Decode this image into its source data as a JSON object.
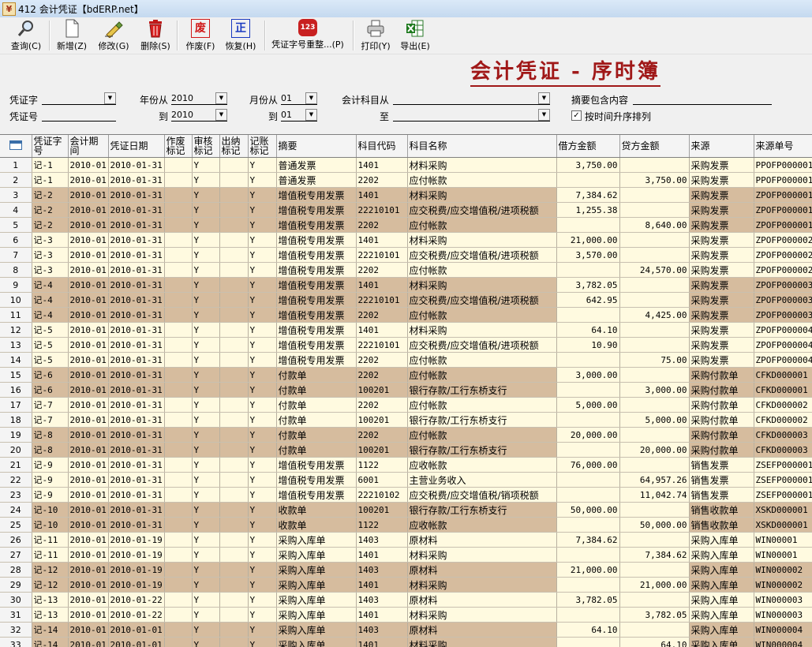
{
  "window": {
    "title": "412 会计凭证【bdERP.net】",
    "icon": "rmb-icon"
  },
  "toolbar": [
    {
      "name": "query-button",
      "icon": "magnifier-icon",
      "label": "查询(C)"
    },
    {
      "name": "new-button",
      "icon": "new-document-icon",
      "label": "新增(Z)"
    },
    {
      "name": "edit-button",
      "icon": "edit-pen-icon",
      "label": "修改(G)"
    },
    {
      "name": "delete-button",
      "icon": "trash-icon",
      "label": "删除(S)"
    },
    {
      "name": "void-button",
      "icon": "void-stamp-icon",
      "glyph": "废",
      "label": "作废(F)"
    },
    {
      "name": "restore-button",
      "icon": "restore-stamp-icon",
      "glyph": "正",
      "label": "恢复(H)"
    },
    {
      "name": "renumber-button",
      "icon": "renumber-icon",
      "glyph": "123",
      "label": "凭证字号重整...(P)"
    },
    {
      "name": "print-button",
      "icon": "printer-icon",
      "label": "打印(Y)"
    },
    {
      "name": "export-button",
      "icon": "excel-icon",
      "label": "导出(E)"
    }
  ],
  "page_title": "会计凭证 - 序时簿",
  "filters": {
    "voucher_word_label": "凭证字",
    "voucher_no_label": "凭证号",
    "year_from_label": "年份从",
    "year_from": "2010",
    "year_to_label": "到",
    "year_to": "2010",
    "month_from_label": "月份从",
    "month_from": "01",
    "month_to_label": "到",
    "month_to": "01",
    "account_from_label": "会计科目从",
    "account_to_label": "至",
    "summary_contains_label": "摘要包含内容",
    "sort_checkbox_label": "按时间升序排列",
    "sort_checked": true
  },
  "columns": [
    "凭证字号",
    "会计期间",
    "凭证日期",
    "作废标记",
    "审核标记",
    "出纳标记",
    "记账标记",
    "摘要",
    "科目代码",
    "科目名称",
    "借方金额",
    "贷方金额",
    "来源",
    "来源单号"
  ],
  "rows": [
    [
      "1",
      "记-1",
      "2010-01",
      "2010-01-31",
      "",
      "Y",
      "",
      "Y",
      "普通发票",
      "1401",
      "材料采购",
      "3,750.00",
      "",
      "采购发票",
      "PPOFP000001"
    ],
    [
      "2",
      "记-1",
      "2010-01",
      "2010-01-31",
      "",
      "Y",
      "",
      "Y",
      "普通发票",
      "2202",
      "应付帐款",
      "",
      "3,750.00",
      "采购发票",
      "PPOFP000001"
    ],
    [
      "3",
      "记-2",
      "2010-01",
      "2010-01-31",
      "",
      "Y",
      "",
      "Y",
      "增值税专用发票",
      "1401",
      "材料采购",
      "7,384.62",
      "",
      "采购发票",
      "ZPOFP000001"
    ],
    [
      "4",
      "记-2",
      "2010-01",
      "2010-01-31",
      "",
      "Y",
      "",
      "Y",
      "增值税专用发票",
      "22210101",
      "应交税费/应交增值税/进项税额",
      "1,255.38",
      "",
      "采购发票",
      "ZPOFP000001"
    ],
    [
      "5",
      "记-2",
      "2010-01",
      "2010-01-31",
      "",
      "Y",
      "",
      "Y",
      "增值税专用发票",
      "2202",
      "应付帐款",
      "",
      "8,640.00",
      "采购发票",
      "ZPOFP000001"
    ],
    [
      "6",
      "记-3",
      "2010-01",
      "2010-01-31",
      "",
      "Y",
      "",
      "Y",
      "增值税专用发票",
      "1401",
      "材料采购",
      "21,000.00",
      "",
      "采购发票",
      "ZPOFP000002"
    ],
    [
      "7",
      "记-3",
      "2010-01",
      "2010-01-31",
      "",
      "Y",
      "",
      "Y",
      "增值税专用发票",
      "22210101",
      "应交税费/应交增值税/进项税额",
      "3,570.00",
      "",
      "采购发票",
      "ZPOFP000002"
    ],
    [
      "8",
      "记-3",
      "2010-01",
      "2010-01-31",
      "",
      "Y",
      "",
      "Y",
      "增值税专用发票",
      "2202",
      "应付帐款",
      "",
      "24,570.00",
      "采购发票",
      "ZPOFP000002"
    ],
    [
      "9",
      "记-4",
      "2010-01",
      "2010-01-31",
      "",
      "Y",
      "",
      "Y",
      "增值税专用发票",
      "1401",
      "材料采购",
      "3,782.05",
      "",
      "采购发票",
      "ZPOFP000003"
    ],
    [
      "10",
      "记-4",
      "2010-01",
      "2010-01-31",
      "",
      "Y",
      "",
      "Y",
      "增值税专用发票",
      "22210101",
      "应交税费/应交增值税/进项税额",
      "642.95",
      "",
      "采购发票",
      "ZPOFP000003"
    ],
    [
      "11",
      "记-4",
      "2010-01",
      "2010-01-31",
      "",
      "Y",
      "",
      "Y",
      "增值税专用发票",
      "2202",
      "应付帐款",
      "",
      "4,425.00",
      "采购发票",
      "ZPOFP000003"
    ],
    [
      "12",
      "记-5",
      "2010-01",
      "2010-01-31",
      "",
      "Y",
      "",
      "Y",
      "增值税专用发票",
      "1401",
      "材料采购",
      "64.10",
      "",
      "采购发票",
      "ZPOFP000004"
    ],
    [
      "13",
      "记-5",
      "2010-01",
      "2010-01-31",
      "",
      "Y",
      "",
      "Y",
      "增值税专用发票",
      "22210101",
      "应交税费/应交增值税/进项税额",
      "10.90",
      "",
      "采购发票",
      "ZPOFP000004"
    ],
    [
      "14",
      "记-5",
      "2010-01",
      "2010-01-31",
      "",
      "Y",
      "",
      "Y",
      "增值税专用发票",
      "2202",
      "应付帐款",
      "",
      "75.00",
      "采购发票",
      "ZPOFP000004"
    ],
    [
      "15",
      "记-6",
      "2010-01",
      "2010-01-31",
      "",
      "Y",
      "",
      "Y",
      "付款单",
      "2202",
      "应付帐款",
      "3,000.00",
      "",
      "采购付款单",
      "CFKD000001"
    ],
    [
      "16",
      "记-6",
      "2010-01",
      "2010-01-31",
      "",
      "Y",
      "",
      "Y",
      "付款单",
      "100201",
      "银行存款/工行东桥支行",
      "",
      "3,000.00",
      "采购付款单",
      "CFKD000001"
    ],
    [
      "17",
      "记-7",
      "2010-01",
      "2010-01-31",
      "",
      "Y",
      "",
      "Y",
      "付款单",
      "2202",
      "应付帐款",
      "5,000.00",
      "",
      "采购付款单",
      "CFKD000002"
    ],
    [
      "18",
      "记-7",
      "2010-01",
      "2010-01-31",
      "",
      "Y",
      "",
      "Y",
      "付款单",
      "100201",
      "银行存款/工行东桥支行",
      "",
      "5,000.00",
      "采购付款单",
      "CFKD000002"
    ],
    [
      "19",
      "记-8",
      "2010-01",
      "2010-01-31",
      "",
      "Y",
      "",
      "Y",
      "付款单",
      "2202",
      "应付帐款",
      "20,000.00",
      "",
      "采购付款单",
      "CFKD000003"
    ],
    [
      "20",
      "记-8",
      "2010-01",
      "2010-01-31",
      "",
      "Y",
      "",
      "Y",
      "付款单",
      "100201",
      "银行存款/工行东桥支行",
      "",
      "20,000.00",
      "采购付款单",
      "CFKD000003"
    ],
    [
      "21",
      "记-9",
      "2010-01",
      "2010-01-31",
      "",
      "Y",
      "",
      "Y",
      "增值税专用发票",
      "1122",
      "应收帐款",
      "76,000.00",
      "",
      "销售发票",
      "ZSEFP000001"
    ],
    [
      "22",
      "记-9",
      "2010-01",
      "2010-01-31",
      "",
      "Y",
      "",
      "Y",
      "增值税专用发票",
      "6001",
      "主营业务收入",
      "",
      "64,957.26",
      "销售发票",
      "ZSEFP000001"
    ],
    [
      "23",
      "记-9",
      "2010-01",
      "2010-01-31",
      "",
      "Y",
      "",
      "Y",
      "增值税专用发票",
      "22210102",
      "应交税费/应交增值税/销项税额",
      "",
      "11,042.74",
      "销售发票",
      "ZSEFP000001"
    ],
    [
      "24",
      "记-10",
      "2010-01",
      "2010-01-31",
      "",
      "Y",
      "",
      "Y",
      "收款单",
      "100201",
      "银行存款/工行东桥支行",
      "50,000.00",
      "",
      "销售收款单",
      "XSKD000001"
    ],
    [
      "25",
      "记-10",
      "2010-01",
      "2010-01-31",
      "",
      "Y",
      "",
      "Y",
      "收款单",
      "1122",
      "应收帐款",
      "",
      "50,000.00",
      "销售收款单",
      "XSKD000001"
    ],
    [
      "26",
      "记-11",
      "2010-01",
      "2010-01-19",
      "",
      "Y",
      "",
      "Y",
      "采购入库单",
      "1403",
      "原材料",
      "7,384.62",
      "",
      "采购入库单",
      "WIN00001"
    ],
    [
      "27",
      "记-11",
      "2010-01",
      "2010-01-19",
      "",
      "Y",
      "",
      "Y",
      "采购入库单",
      "1401",
      "材料采购",
      "",
      "7,384.62",
      "采购入库单",
      "WIN00001"
    ],
    [
      "28",
      "记-12",
      "2010-01",
      "2010-01-19",
      "",
      "Y",
      "",
      "Y",
      "采购入库单",
      "1403",
      "原材料",
      "21,000.00",
      "",
      "采购入库单",
      "WIN000002"
    ],
    [
      "29",
      "记-12",
      "2010-01",
      "2010-01-19",
      "",
      "Y",
      "",
      "Y",
      "采购入库单",
      "1401",
      "材料采购",
      "",
      "21,000.00",
      "采购入库单",
      "WIN000002"
    ],
    [
      "30",
      "记-13",
      "2010-01",
      "2010-01-22",
      "",
      "Y",
      "",
      "Y",
      "采购入库单",
      "1403",
      "原材料",
      "3,782.05",
      "",
      "采购入库单",
      "WIN000003"
    ],
    [
      "31",
      "记-13",
      "2010-01",
      "2010-01-22",
      "",
      "Y",
      "",
      "Y",
      "采购入库单",
      "1401",
      "材料采购",
      "",
      "3,782.05",
      "采购入库单",
      "WIN000003"
    ],
    [
      "32",
      "记-14",
      "2010-01",
      "2010-01-01",
      "",
      "Y",
      "",
      "Y",
      "采购入库单",
      "1403",
      "原材料",
      "64.10",
      "",
      "采购入库单",
      "WIN000004"
    ],
    [
      "33",
      "记-14",
      "2010-01",
      "2010-01-01",
      "",
      "Y",
      "",
      "Y",
      "采购入库单",
      "1401",
      "材料采购",
      "",
      "64.10",
      "采购入库单",
      "WIN000004"
    ]
  ],
  "colors": {
    "row_light": "#fffae0",
    "row_dark": "#d6bc9e",
    "title_red": "#a01818"
  }
}
